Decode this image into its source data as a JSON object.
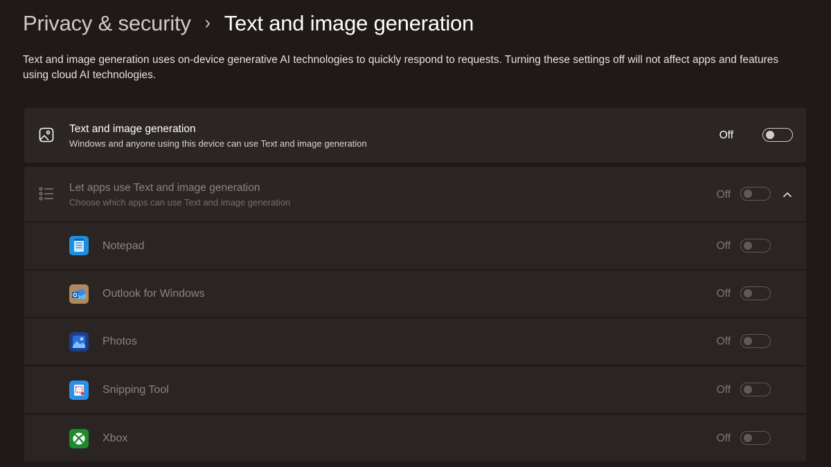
{
  "header": {
    "parent": "Privacy & security",
    "separator": "›",
    "current": "Text and image generation"
  },
  "description": "Text and image generation uses on-device generative AI technologies to quickly respond to requests. Turning these settings off will not affect apps and features using cloud AI technologies.",
  "main_setting": {
    "icon": "image-icon",
    "title": "Text and image generation",
    "subtitle": "Windows and anyone using this device can use Text and image generation",
    "state_label": "Off",
    "enabled": false
  },
  "apps_setting": {
    "icon": "list-icon",
    "title": "Let apps use Text and image generation",
    "subtitle": "Choose which apps can use Text and image generation",
    "state_label": "Off",
    "enabled": false,
    "expanded": true
  },
  "apps": [
    {
      "name": "Notepad",
      "icon": "notepad-icon",
      "state_label": "Off",
      "enabled": false,
      "icon_color": "#1e8fe0"
    },
    {
      "name": "Outlook for Windows",
      "icon": "outlook-icon",
      "state_label": "Off",
      "enabled": false,
      "icon_color": "#b08a5a"
    },
    {
      "name": "Photos",
      "icon": "photos-icon",
      "state_label": "Off",
      "enabled": false,
      "icon_color": "#2a5fb8"
    },
    {
      "name": "Snipping Tool",
      "icon": "snipping-tool-icon",
      "state_label": "Off",
      "enabled": false,
      "icon_color": "#2c8fe6"
    },
    {
      "name": "Xbox",
      "icon": "xbox-icon",
      "state_label": "Off",
      "enabled": false,
      "icon_color": "#1e8a2e"
    }
  ],
  "colors": {
    "background": "#1f1a17",
    "card": "#2b2623",
    "text_primary": "#ffffff",
    "text_disabled": "#8a8480"
  }
}
